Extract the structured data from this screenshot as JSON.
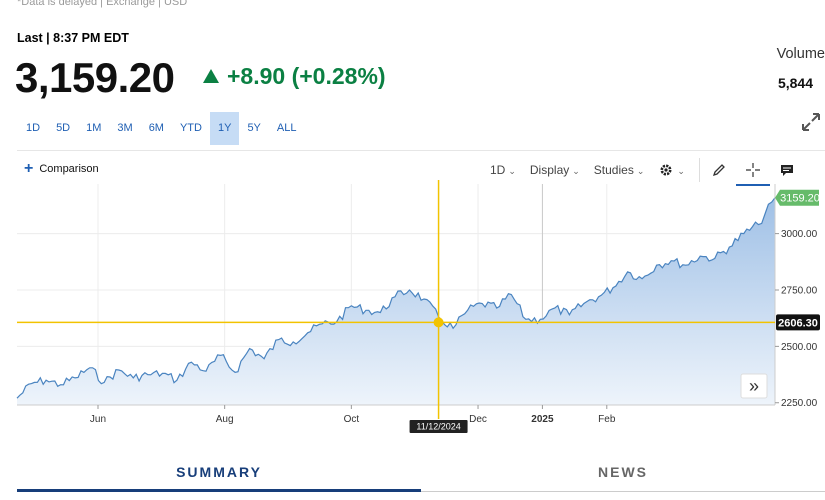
{
  "header": {
    "note": "*Data is delayed | Exchange | USD",
    "last_label": "Last | 8:37 PM EDT",
    "price": "3,159.20",
    "change": "+8.90 (+0.28%)",
    "volume_label": "Volume",
    "volume_value": "5,844",
    "change_color": "#0b8043"
  },
  "ranges": [
    {
      "label": "1D",
      "active": false
    },
    {
      "label": "5D",
      "active": false
    },
    {
      "label": "1M",
      "active": false
    },
    {
      "label": "3M",
      "active": false
    },
    {
      "label": "6M",
      "active": false
    },
    {
      "label": "YTD",
      "active": false
    },
    {
      "label": "1Y",
      "active": true
    },
    {
      "label": "5Y",
      "active": false
    },
    {
      "label": "ALL",
      "active": false
    }
  ],
  "toolbar": {
    "comparison": "Comparison",
    "interval": "1D",
    "display": "Display",
    "studies": "Studies",
    "icons": [
      "gear-icon",
      "pencil-icon",
      "crosshair-icon",
      "comment-icon"
    ]
  },
  "tabs": [
    {
      "label": "SUMMARY",
      "active": true
    },
    {
      "label": "NEWS",
      "active": false
    }
  ],
  "chart_data": {
    "type": "area",
    "x_start": "2024-04-23",
    "x_end": "2025-04-23",
    "x_ticks": [
      {
        "label": "Jun",
        "date": "2024-06-01",
        "bold": false
      },
      {
        "label": "Aug",
        "date": "2024-08-01",
        "bold": false
      },
      {
        "label": "Oct",
        "date": "2024-10-01",
        "bold": false
      },
      {
        "label": "Dec",
        "date": "2024-12-01",
        "bold": false
      },
      {
        "label": "2025",
        "date": "2025-01-01",
        "bold": true
      },
      {
        "label": "Feb",
        "date": "2025-02-01",
        "bold": false
      }
    ],
    "y_ticks": [
      {
        "label": "3000.00",
        "value": 3000
      },
      {
        "label": "2750.00",
        "value": 2750
      },
      {
        "label": "2500.00",
        "value": 2500
      },
      {
        "label": "2250.00",
        "value": 2250
      }
    ],
    "ylim": [
      2240,
      3220
    ],
    "series": [
      {
        "dates": [
          "2024-04-23",
          "2024-04-30",
          "2024-05-07",
          "2024-05-14",
          "2024-05-21",
          "2024-05-28",
          "2024-06-04",
          "2024-06-11",
          "2024-06-18",
          "2024-06-25",
          "2024-07-02",
          "2024-07-09",
          "2024-07-16",
          "2024-07-23",
          "2024-07-30",
          "2024-08-06",
          "2024-08-13",
          "2024-08-20",
          "2024-08-27",
          "2024-09-03",
          "2024-09-10",
          "2024-09-17",
          "2024-09-24",
          "2024-10-01",
          "2024-10-08",
          "2024-10-15",
          "2024-10-22",
          "2024-10-29",
          "2024-11-05",
          "2024-11-12",
          "2024-11-19",
          "2024-11-26",
          "2024-12-03",
          "2024-12-10",
          "2024-12-17",
          "2024-12-24",
          "2024-12-31",
          "2025-01-07",
          "2025-01-14",
          "2025-01-21",
          "2025-01-28",
          "2025-02-04",
          "2025-02-11",
          "2025-02-18",
          "2025-02-25",
          "2025-03-04",
          "2025-03-11",
          "2025-03-18",
          "2025-03-25",
          "2025-04-01",
          "2025-04-08",
          "2025-04-15",
          "2025-04-23"
        ],
        "values": [
          2270,
          2335,
          2350,
          2330,
          2360,
          2405,
          2340,
          2395,
          2360,
          2375,
          2380,
          2350,
          2430,
          2390,
          2460,
          2385,
          2490,
          2445,
          2530,
          2520,
          2560,
          2600,
          2610,
          2680,
          2660,
          2650,
          2720,
          2750,
          2710,
          2630,
          2580,
          2660,
          2690,
          2670,
          2730,
          2620,
          2620,
          2670,
          2640,
          2690,
          2720,
          2760,
          2830,
          2800,
          2860,
          2880,
          2860,
          2900,
          2890,
          2940,
          3000,
          3040,
          3159.2
        ]
      }
    ],
    "last_value_label": "3159.20",
    "crosshair": {
      "date_label": "11/12/2024",
      "date": "2024-11-12",
      "value_label": "2606.30",
      "value": 2606.3
    },
    "colors": {
      "line": "#4a84c0",
      "fill_top": "#9fc0e6",
      "fill_bottom": "#eef4fb",
      "crosshair": "#f2c300",
      "last_badge": "#66bb6a",
      "grid": "#ececec"
    }
  },
  "scroll_button": "»"
}
